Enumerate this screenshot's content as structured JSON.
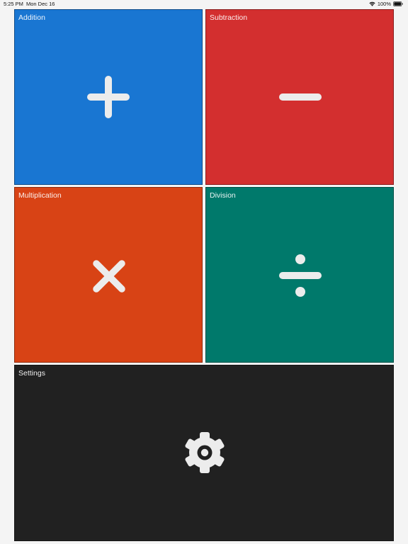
{
  "status_bar": {
    "time": "5:25 PM",
    "date": "Mon Dec 16",
    "battery_percent": "100%",
    "icons": [
      "wifi-icon",
      "battery-icon"
    ]
  },
  "tiles": {
    "addition": {
      "label": "Addition",
      "color": "#1976d2",
      "icon": "plus-icon"
    },
    "subtraction": {
      "label": "Subtraction",
      "color": "#d32f2f",
      "icon": "minus-icon"
    },
    "multiplication": {
      "label": "Multiplication",
      "color": "#d84315",
      "icon": "multiply-icon"
    },
    "division": {
      "label": "Division",
      "color": "#00796b",
      "icon": "divide-icon"
    },
    "settings": {
      "label": "Settings",
      "color": "#212121",
      "icon": "gear-icon"
    }
  },
  "colors": {
    "background": "#f4f4f4",
    "icon_fill": "#ececec",
    "label_text": "#ffffff"
  }
}
